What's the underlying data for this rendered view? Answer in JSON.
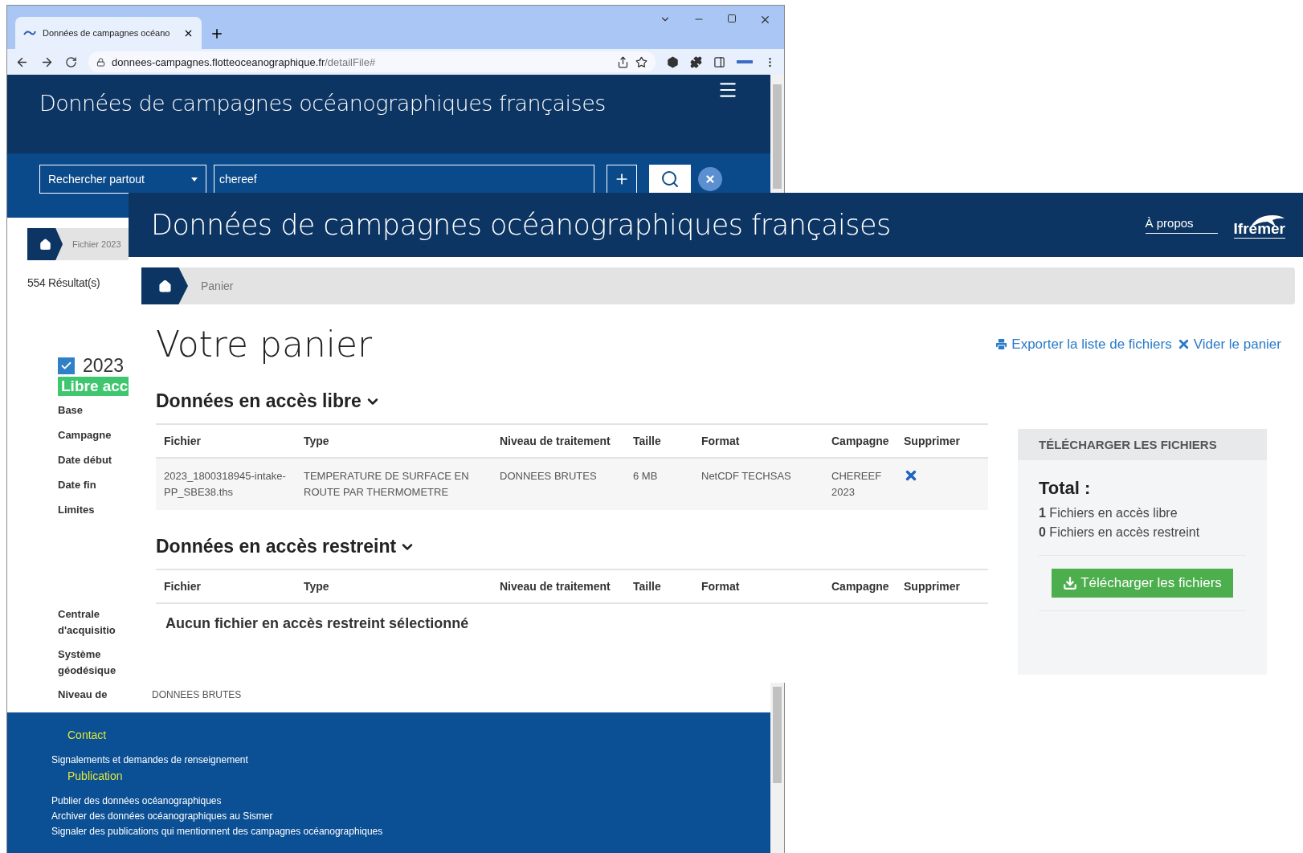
{
  "browser": {
    "tab": {
      "title": "Données de campagnes océano",
      "selected": true
    },
    "url_domain": "donnees-campagnes.flotteoceanographique.fr",
    "url_path": "/detailFile#"
  },
  "back_page": {
    "site_title": "Données de campagnes océanographiques françaises",
    "search": {
      "scope": "Rechercher partout",
      "query": "chereef"
    },
    "breadcrumb": "Fichier 2023",
    "results": "554 Résultat(s)",
    "item": {
      "checked": true,
      "title": "2023",
      "badge": "Libre acc"
    },
    "fields": [
      {
        "label": "Base"
      },
      {
        "label": "Campagne"
      },
      {
        "label": "Date début"
      },
      {
        "label": "Date fin"
      },
      {
        "label": "Limites"
      }
    ],
    "acquisition_fields": [
      {
        "label": "Centrale d'acquisitio"
      },
      {
        "label": "Système géodésique"
      },
      {
        "label": "Niveau de",
        "value": "DONNEES BRUTES"
      }
    ],
    "footer": [
      {
        "heading": "Contact",
        "links": [
          "Signalements et demandes de renseignement"
        ]
      },
      {
        "heading": "Publication",
        "links": [
          "Publier des données océanographiques",
          "Archiver des données océanographiques au Sismer",
          "Signaler des publications qui mentionnent des campagnes océanographiques"
        ]
      }
    ]
  },
  "cart_page": {
    "site_title": "Données de campagnes océanographiques françaises",
    "about": "À propos",
    "logo": "Ifremer",
    "breadcrumb": "Panier",
    "heading": "Votre panier",
    "actions": [
      {
        "label": "Exporter la liste de fichiers",
        "kind": "print"
      },
      {
        "label": "Vider le panier",
        "kind": "clear"
      }
    ],
    "sections": [
      {
        "title": "Données en accès libre",
        "expanded": true,
        "columns": [
          "Fichier",
          "Type",
          "Niveau de traitement",
          "Taille",
          "Format",
          "Campagne",
          "Supprimer"
        ],
        "rows": [
          {
            "cells": [
              "2023_1800318945-intake-PP_SBE38.ths",
              "TEMPERATURE DE SURFACE EN ROUTE PAR THERMOMETRE",
              "DONNEES BRUTES",
              "6 MB",
              "NetCDF TECHSAS",
              "CHEREEF 2023"
            ]
          }
        ]
      },
      {
        "title": "Données en accès restreint",
        "expanded": true,
        "columns": [
          "Fichier",
          "Type",
          "Niveau de traitement",
          "Taille",
          "Format",
          "Campagne",
          "Supprimer"
        ],
        "empty": "Aucun fichier en accès restreint sélectionné"
      }
    ],
    "download": {
      "title": "TÉLÉCHARGER LES FICHIERS",
      "total": "Total :",
      "counts": [
        {
          "count": "1",
          "label": "Fichiers en accès libre"
        },
        {
          "count": "0",
          "label": "Fichiers en accès restreint"
        }
      ],
      "button": "Télécharger les fichiers"
    }
  }
}
